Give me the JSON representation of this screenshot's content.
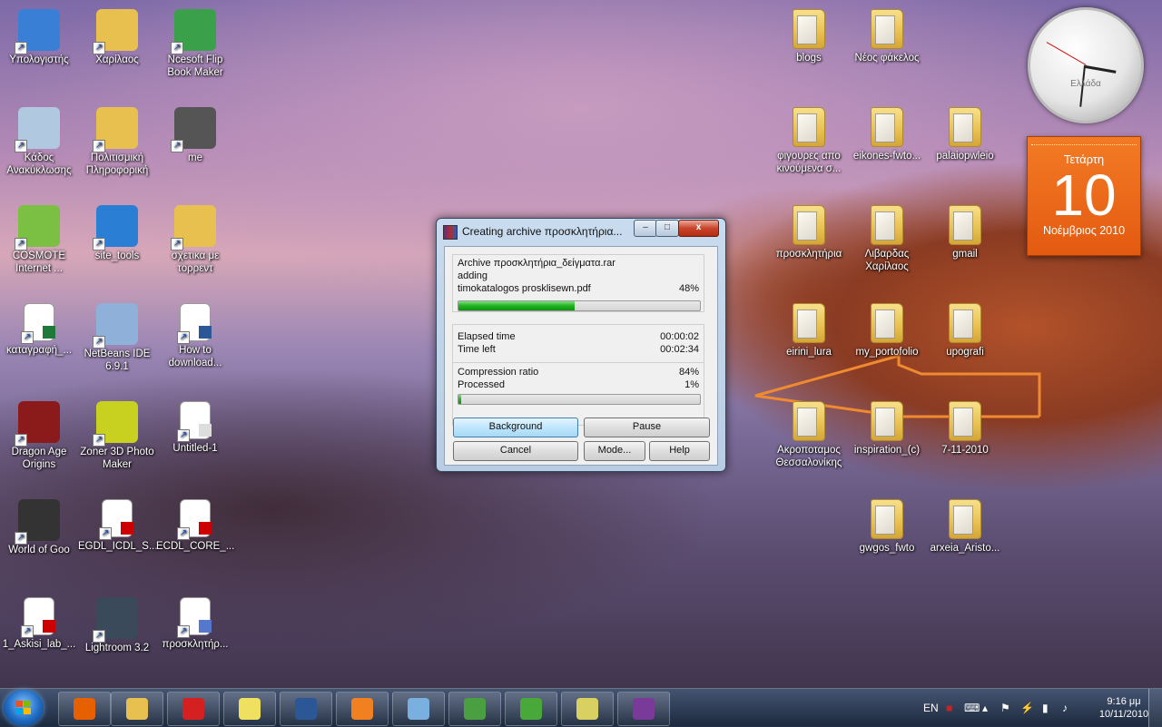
{
  "desktop": {
    "left_icons": [
      {
        "label": "Υπολογιστής",
        "icon": "computer-icon",
        "color": "#3a7fd6"
      },
      {
        "label": "Χαρίλαος",
        "icon": "user-folder-icon",
        "color": "#e8c050"
      },
      {
        "label": "Ncesoft Flip Book Maker",
        "icon": "flipbook-app-icon",
        "color": "#3aa04a"
      },
      {
        "label": "Κάδος Ανακύκλωσης",
        "icon": "recycle-bin-icon",
        "color": "#b0c8e0"
      },
      {
        "label": "Πολιτισμική Πληροφορική",
        "icon": "folder-icon",
        "color": "#e8c050"
      },
      {
        "label": "me",
        "icon": "photo-icon",
        "color": "#555555"
      },
      {
        "label": "COSMOTE Internet ...",
        "icon": "cosmote-icon",
        "color": "#7bc043"
      },
      {
        "label": "site_tools",
        "icon": "globe-icon",
        "color": "#2a7fd4"
      },
      {
        "label": "σχετικα με τορρεντ",
        "icon": "folder-icon",
        "color": "#e8c050"
      },
      {
        "label": "καταγραφή_...",
        "icon": "excel-icon",
        "color": "#1f7a3a"
      },
      {
        "label": "NetBeans IDE 6.9.1",
        "icon": "netbeans-icon",
        "color": "#8fb0d8"
      },
      {
        "label": "How to download...",
        "icon": "word-doc-icon",
        "color": "#2b5797"
      },
      {
        "label": "Dragon Age Origins",
        "icon": "dragon-age-icon",
        "color": "#8b1a1a"
      },
      {
        "label": "Zoner 3D Photo Maker",
        "icon": "film-icon",
        "color": "#c8d020"
      },
      {
        "label": "Untitled-1",
        "icon": "image-file-icon",
        "color": "#dddddd"
      },
      {
        "label": "World of Goo",
        "icon": "world-of-goo-icon",
        "color": "#333333"
      },
      {
        "label": "EGDL_ICDL_S...",
        "icon": "pdf-icon",
        "color": "#cc0000"
      },
      {
        "label": "ECDL_CORE_...",
        "icon": "pdf-icon",
        "color": "#cc0000"
      },
      {
        "label": "1_Askisi_lab_...",
        "icon": "pdf-icon",
        "color": "#cc0000"
      },
      {
        "label": "Lightroom 3.2",
        "icon": "lightroom-icon",
        "color": "#3b4a5a"
      },
      {
        "label": "προσκλητήρ...",
        "icon": "image-file-icon",
        "color": "#5577cc"
      }
    ],
    "right_icons": [
      {
        "label": "blogs",
        "icon": "folder-icon"
      },
      {
        "label": "Νέος φάκελος",
        "icon": "folder-icon"
      },
      {
        "label": "φιγουρες απο κινούμενα σ...",
        "icon": "folder-icon"
      },
      {
        "label": "eikones-fwto...",
        "icon": "folder-icon"
      },
      {
        "label": "palaiopwleio",
        "icon": "folder-icon"
      },
      {
        "label": "προσκλητήρια",
        "icon": "folder-icon"
      },
      {
        "label": "Λιβαρδας Χαρίλαος",
        "icon": "folder-icon"
      },
      {
        "label": "gmail",
        "icon": "folder-icon"
      },
      {
        "label": "eirini_lura",
        "icon": "folder-icon"
      },
      {
        "label": "my_portofolio",
        "icon": "folder-icon"
      },
      {
        "label": "upografi",
        "icon": "folder-icon"
      },
      {
        "label": "Ακροποταμος Θεσσαλονίκης",
        "icon": "folder-icon"
      },
      {
        "label": "inspiration_(c)",
        "icon": "folder-icon"
      },
      {
        "label": "7-11-2010",
        "icon": "folder-icon"
      },
      {
        "label": "gwgos_fwto",
        "icon": "folder-icon"
      },
      {
        "label": "arxeia_Aristo...",
        "icon": "folder-icon"
      }
    ]
  },
  "gadgets": {
    "clock": {
      "label": "Ελλάδα",
      "hour_deg": 100,
      "minute_deg": 186,
      "second_deg": 300
    },
    "calendar": {
      "weekday": "Τετάρτη",
      "day": "10",
      "month_year": "Νοέμβριος 2010"
    }
  },
  "winrar": {
    "title": "Creating archive προσκλητήρια...",
    "close_glyph": "x",
    "min_glyph": "–",
    "max_glyph": "□",
    "archive_line": "Archive προσκλητήρια_δείγματα.rar",
    "action": "adding",
    "file": "timokatalogos prosklisewn.pdf",
    "file_percent": "48%",
    "file_progress": 0.48,
    "elapsed_label": "Elapsed time",
    "elapsed_value": "00:00:02",
    "left_label": "Time left",
    "left_value": "00:02:34",
    "ratio_label": "Compression ratio",
    "ratio_value": "84%",
    "processed_label": "Processed",
    "processed_value": "1%",
    "total_progress": 0.01,
    "buttons": {
      "background": "Background",
      "pause": "Pause",
      "cancel": "Cancel",
      "mode": "Mode...",
      "help": "Help"
    }
  },
  "taskbar": {
    "items": [
      {
        "name": "firefox",
        "color": "#e66000"
      },
      {
        "name": "explorer",
        "color": "#e8c050"
      },
      {
        "name": "power",
        "color": "#d42020"
      },
      {
        "name": "sticky-notes",
        "color": "#f0e060"
      },
      {
        "name": "word",
        "color": "#2b5797"
      },
      {
        "name": "media-player",
        "color": "#f08020"
      },
      {
        "name": "notepad",
        "color": "#7ab0e0"
      },
      {
        "name": "messenger",
        "color": "#4aa040"
      },
      {
        "name": "utorrent",
        "color": "#49a83a"
      },
      {
        "name": "paint",
        "color": "#d8d060"
      },
      {
        "name": "winrar",
        "color": "#7a3a9a"
      }
    ],
    "tray": {
      "lang": "EN",
      "time": "9:16 μμ",
      "date": "10/11/2010"
    }
  },
  "annotation": {
    "arrow_color": "#f08a30"
  }
}
